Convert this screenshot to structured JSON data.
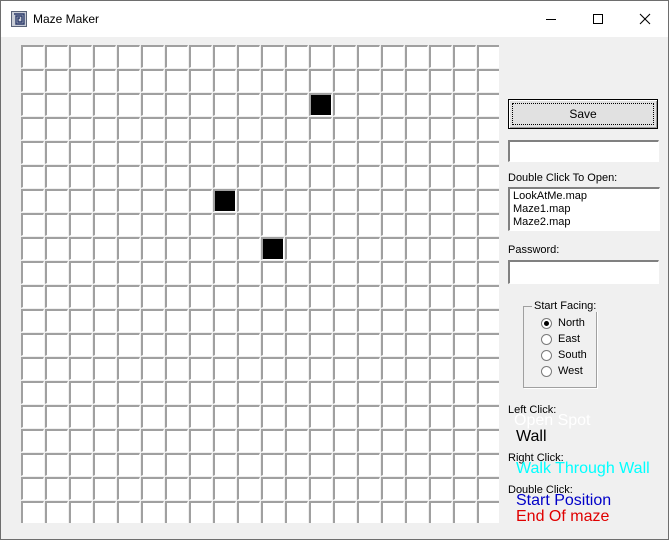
{
  "window": {
    "title": "Maze Maker"
  },
  "titlebar_icons": {
    "app": "app-icon",
    "minimize": "minimize-icon",
    "maximize": "maximize-icon",
    "close": "close-icon"
  },
  "grid": {
    "cols": 20,
    "rows": 20,
    "walls": [
      [
        12,
        2
      ],
      [
        8,
        6
      ],
      [
        10,
        8
      ]
    ],
    "wall_color": "#000000",
    "empty_color": "#ffffff"
  },
  "controls": {
    "save_label": "Save",
    "filename_value": "",
    "open_label": "Double Click To Open:",
    "files": [
      "LookAtMe.map",
      "Maze1.map",
      "Maze2.map"
    ],
    "password_label": "Password:",
    "password_value": ""
  },
  "start_facing": {
    "label": "Start Facing:",
    "options": [
      "North",
      "East",
      "South",
      "West"
    ],
    "selected": "North"
  },
  "legend": {
    "left_click_label": "Left Click:",
    "left_click_alt": "Open Spot",
    "left_click_value": "Wall",
    "right_click_label": "Right Click:",
    "right_click_value": "Walk Through Wall",
    "double_click_label": "Double Click:",
    "double_click_value1": "Start Position",
    "double_click_value2": "End Of maze",
    "colors": {
      "open_spot": "#ffffff",
      "wall": "#000000",
      "walk_through": "#00ffff",
      "start": "#0000c8",
      "end": "#e00000"
    }
  }
}
